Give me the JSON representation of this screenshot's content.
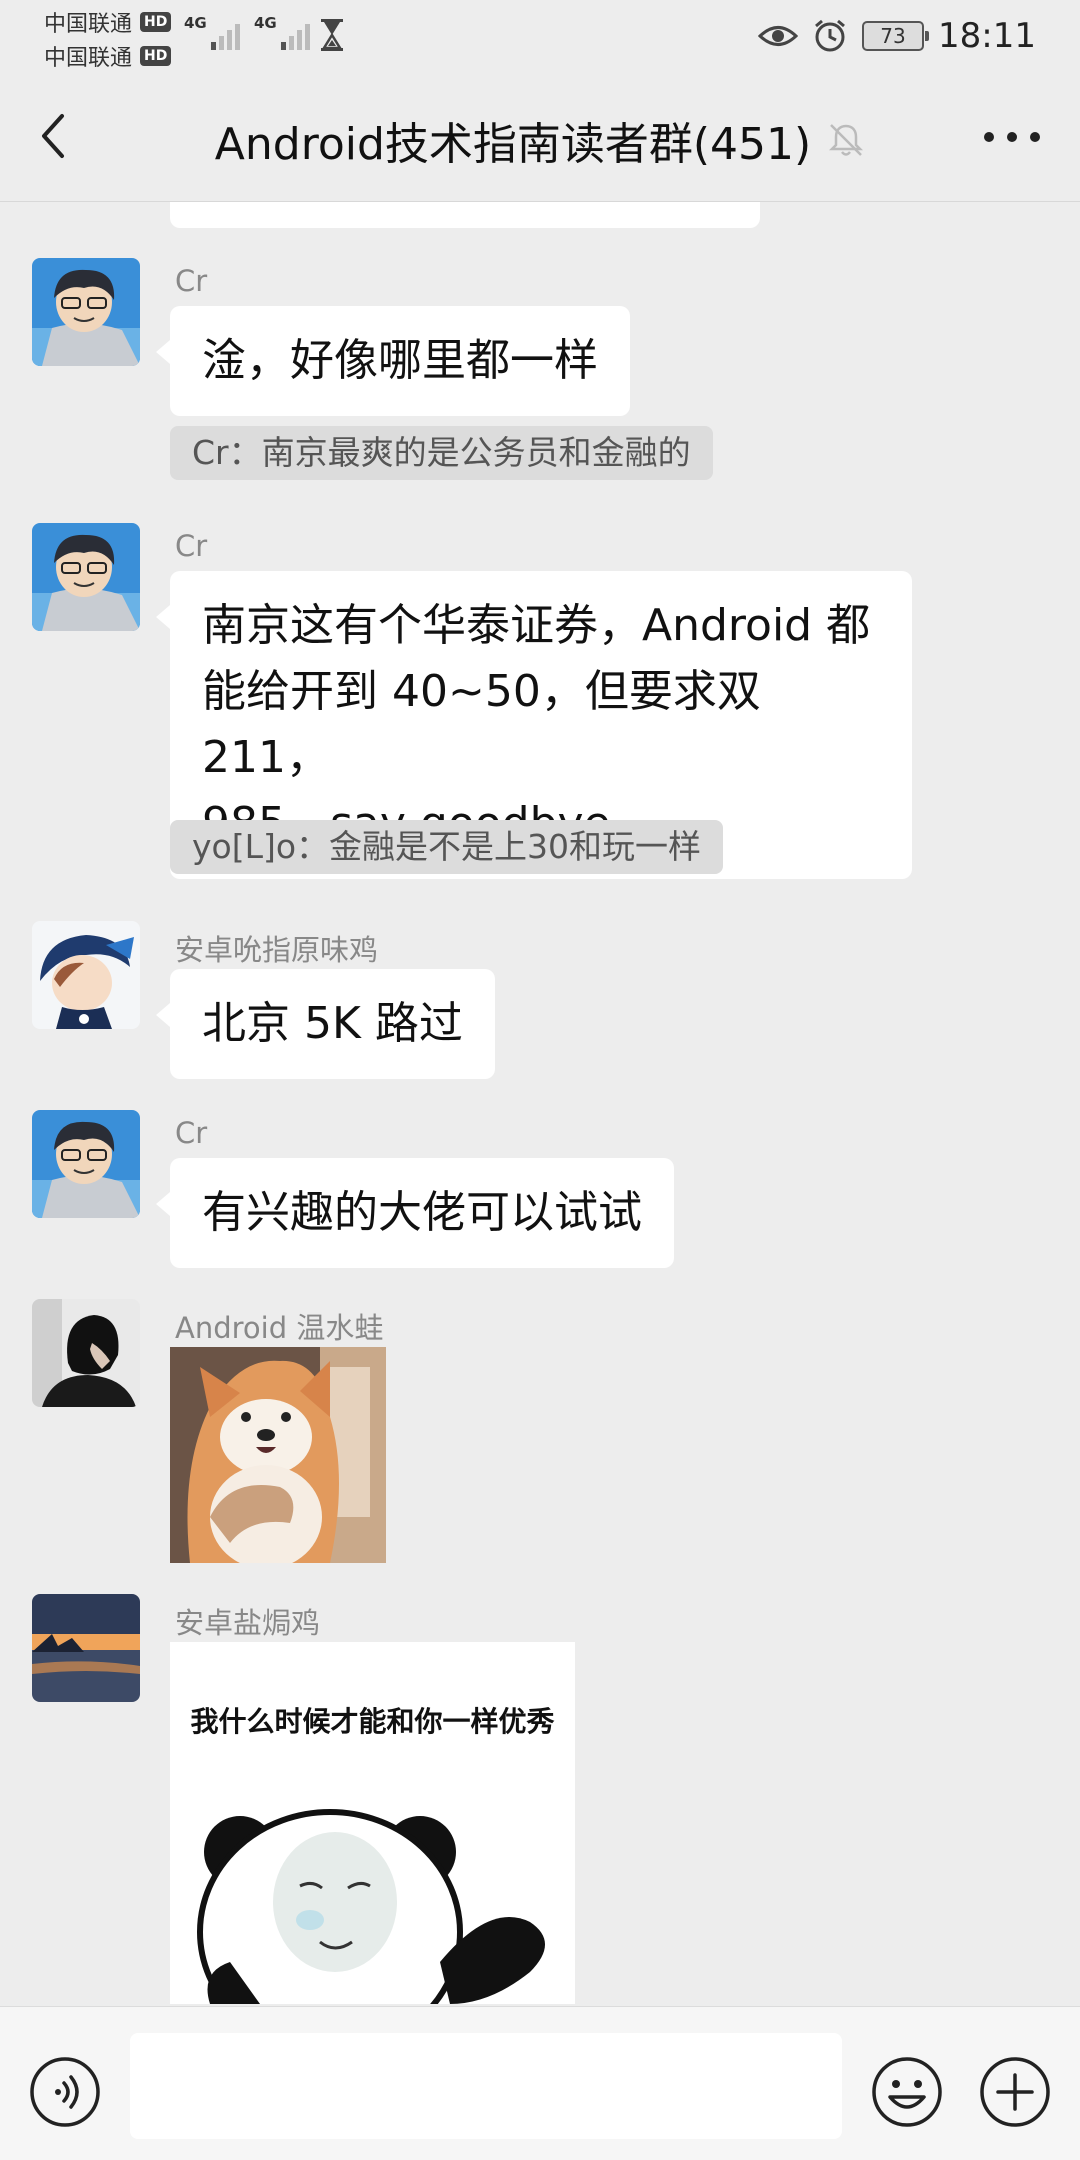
{
  "status_bar": {
    "carrier1": "中国联通",
    "carrier2": "中国联通",
    "hd_badge": "HD",
    "network1": "4G",
    "network2": "4G",
    "battery": "73",
    "time": "18:11"
  },
  "header": {
    "title": "Android技术指南读者群(451)",
    "icons": [
      "back-icon",
      "mute-icon",
      "more-icon"
    ]
  },
  "messages": [
    {
      "sender": "Cr",
      "text": "淦，好像哪里都一样",
      "quote": "Cr：南京最爽的是公务员和金融的"
    },
    {
      "sender": "Cr",
      "lines": [
        "南京这有个华泰证券，Android 都",
        "能给开到 40~50，但要求双 211，",
        "985，say goodbye"
      ],
      "quote": "yo[L]o：金融是不是上30和玩一样"
    },
    {
      "sender": "安卓吮指原味鸡",
      "text": "北京 5K 路过"
    },
    {
      "sender": "Cr",
      "text": "有兴趣的大佬可以试试"
    },
    {
      "sender": "Android 温水蛙",
      "sticker": "shiba-dog-sticker"
    },
    {
      "sender": "安卓盐焗鸡",
      "sticker": "panda-meme-sticker",
      "sticker_text": "我什么时候才能和你一样优秀"
    }
  ],
  "input_bar": {
    "placeholder": "",
    "icons": [
      "voice-icon",
      "emoji-icon",
      "plus-icon"
    ]
  },
  "colors": {
    "background": "#ededed",
    "bubble": "#ffffff",
    "quote_bg": "#dcdcdc",
    "sender_text": "#888888"
  }
}
